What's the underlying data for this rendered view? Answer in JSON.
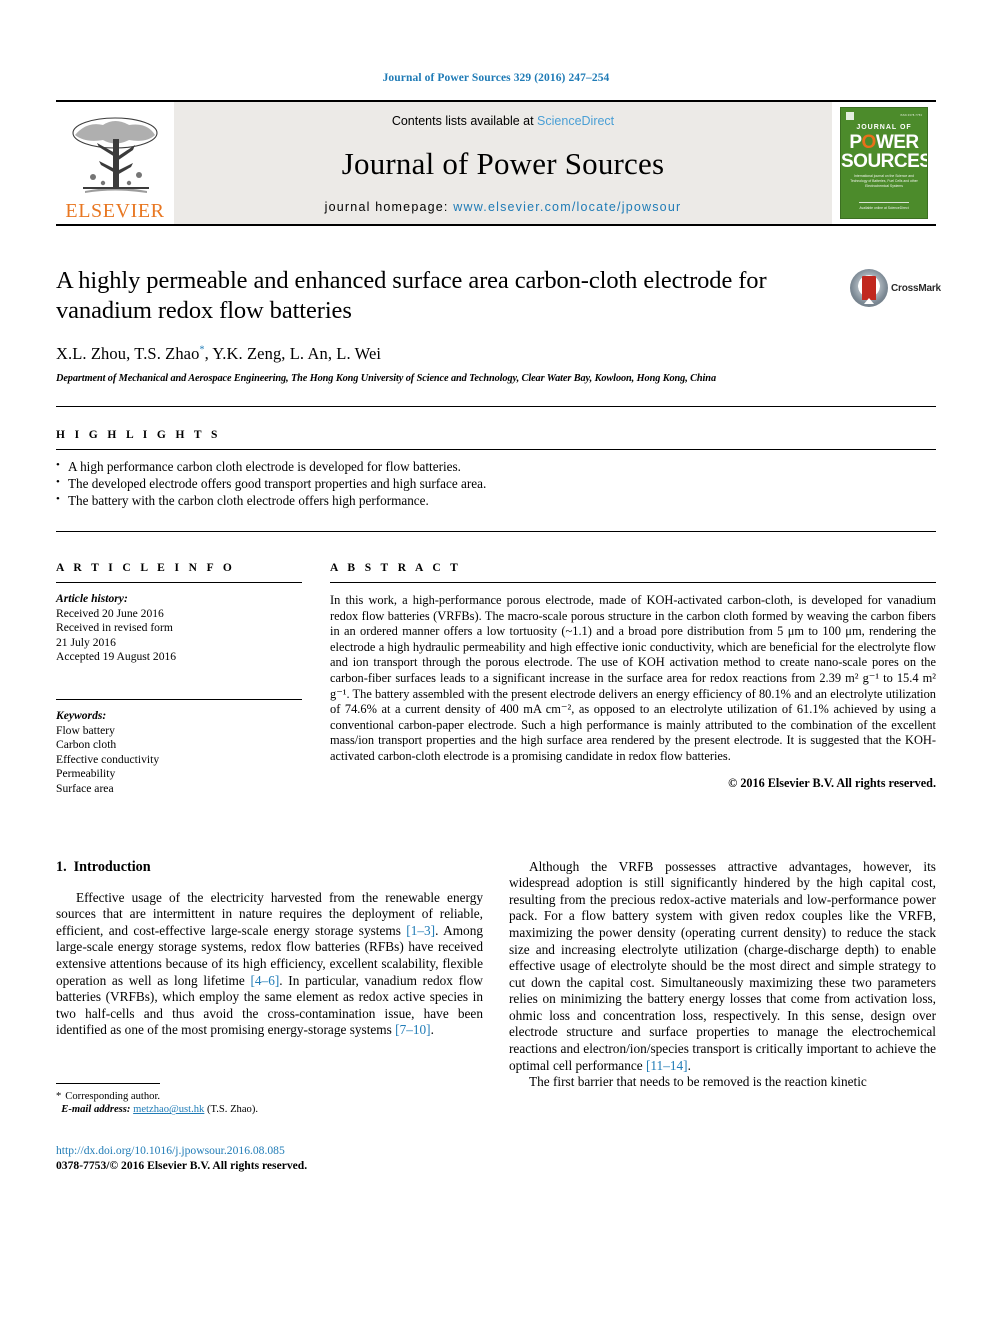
{
  "running_head": "Journal of Power Sources 329 (2016) 247–254",
  "masthead": {
    "publisher_wordmark": "ELSEVIER",
    "contents_prefix": "Contents lists available at ",
    "contents_link": "ScienceDirect",
    "journal_name": "Journal of Power Sources",
    "homepage_prefix": "journal homepage: ",
    "homepage_url": "www.elsevier.com/locate/jpowsour",
    "cover": {
      "line1": "JOURNAL OF",
      "line2_pre": "P",
      "line2_o": "O",
      "line2_post": "WER",
      "line3": "SOURCES",
      "blurb": "International journal on the Science and Technology of Batteries, Fuel Cells and other Electrochemical Systems",
      "footer": "Available online at ScienceDirect"
    }
  },
  "article": {
    "title": "A highly permeable and enhanced surface area carbon-cloth electrode for vanadium redox flow batteries",
    "crossmark_label": "CrossMark",
    "authors": "X.L. Zhou, T.S. Zhao",
    "authors_rest": ", Y.K. Zeng, L. An, L. Wei",
    "corresponding_marker": "*",
    "affiliation": "Department of Mechanical and Aerospace Engineering, The Hong Kong University of Science and Technology, Clear Water Bay, Kowloon, Hong Kong, China"
  },
  "highlights": {
    "label": "H I G H L I G H T S",
    "items": [
      "A high performance carbon cloth electrode is developed for flow batteries.",
      "The developed electrode offers good transport properties and high surface area.",
      "The battery with the carbon cloth electrode offers high performance."
    ]
  },
  "article_info": {
    "label": "A R T I C L E   I N F O",
    "history_label": "Article history:",
    "history": [
      "Received 20 June 2016",
      "Received in revised form",
      "21 July 2016",
      "Accepted 19 August 2016"
    ],
    "keywords_label": "Keywords:",
    "keywords": [
      "Flow battery",
      "Carbon cloth",
      "Effective conductivity",
      "Permeability",
      "Surface area"
    ]
  },
  "abstract": {
    "label": "A B S T R A C T",
    "text": "In this work, a high-performance porous electrode, made of KOH-activated carbon-cloth, is developed for vanadium redox flow batteries (VRFBs). The macro-scale porous structure in the carbon cloth formed by weaving the carbon fibers in an ordered manner offers a low tortuosity (~1.1) and a broad pore distribution from 5 μm to 100 μm, rendering the electrode a high hydraulic permeability and high effective ionic conductivity, which are beneficial for the electrolyte flow and ion transport through the porous electrode. The use of KOH activation method to create nano-scale pores on the carbon-fiber surfaces leads to a significant increase in the surface area for redox reactions from 2.39 m² g⁻¹ to 15.4 m² g⁻¹. The battery assembled with the present electrode delivers an energy efficiency of 80.1% and an electrolyte utilization of 74.6% at a current density of 400 mA cm⁻², as opposed to an electrolyte utilization of 61.1% achieved by using a conventional carbon-paper electrode. Such a high performance is mainly attributed to the combination of the excellent mass/ion transport properties and the high surface area rendered by the present electrode. It is suggested that the KOH-activated carbon-cloth electrode is a promising candidate in redox flow batteries.",
    "copyright": "© 2016 Elsevier B.V. All rights reserved."
  },
  "introduction": {
    "number": "1.",
    "heading": "Introduction",
    "left_para_1a": "Effective usage of the electricity harvested from the renewable energy sources that are intermittent in nature requires the deployment of reliable, efficient, and cost-effective large-scale energy storage systems ",
    "left_ref_1": "[1–3]",
    "left_para_1b": ". Among large-scale energy storage systems, redox flow batteries (RFBs) have received extensive attentions because of its high efficiency, excellent scalability, flexible operation as well as long lifetime ",
    "left_ref_2": "[4–6]",
    "left_para_1c": ". In particular, vanadium redox flow batteries (VRFBs), which employ the same element as redox active species in two half-cells and thus avoid the cross-contamination issue, have been identified as one of the most promising energy-storage systems ",
    "left_ref_3": "[7–10]",
    "left_para_1d": ".",
    "right_para_1a": "Although the VRFB possesses attractive advantages, however, its widespread adoption is still significantly hindered by the high capital cost, resulting from the precious redox-active materials and low-performance power pack. For a flow battery system with given redox couples like the VRFB, maximizing the power density (operating current density) to reduce the stack size and increasing electrolyte utilization (charge-discharge depth) to enable effective usage of electrolyte should be the most direct and simple strategy to cut down the capital cost. Simultaneously maximizing these two parameters relies on minimizing the battery energy losses that come from activation loss, ohmic loss and concentration loss, respectively. In this sense, design over electrode structure and surface properties to manage the electrochemical reactions and electron/ion/species transport is critically important to achieve the optimal cell performance ",
    "right_ref_1": "[11–14]",
    "right_para_1b": ".",
    "right_para_2": "The first barrier that needs to be removed is the reaction kinetic"
  },
  "footer": {
    "corresponding_star": "*",
    "corresponding_label": "Corresponding author.",
    "email_label": "E-mail address:",
    "email": "metzhao@ust.hk",
    "email_suffix": "(T.S. Zhao).",
    "doi": "http://dx.doi.org/10.1016/j.jpowsour.2016.08.085",
    "issn": "0378-7753/© 2016 Elsevier B.V. All rights reserved."
  },
  "colors": {
    "link_blue": "#1f7bb6",
    "sciencedirect_blue": "#4a9fd5",
    "elsevier_orange": "#E87722",
    "cover_green": "#4c8b2b",
    "crossmark_red": "#c1281f"
  }
}
